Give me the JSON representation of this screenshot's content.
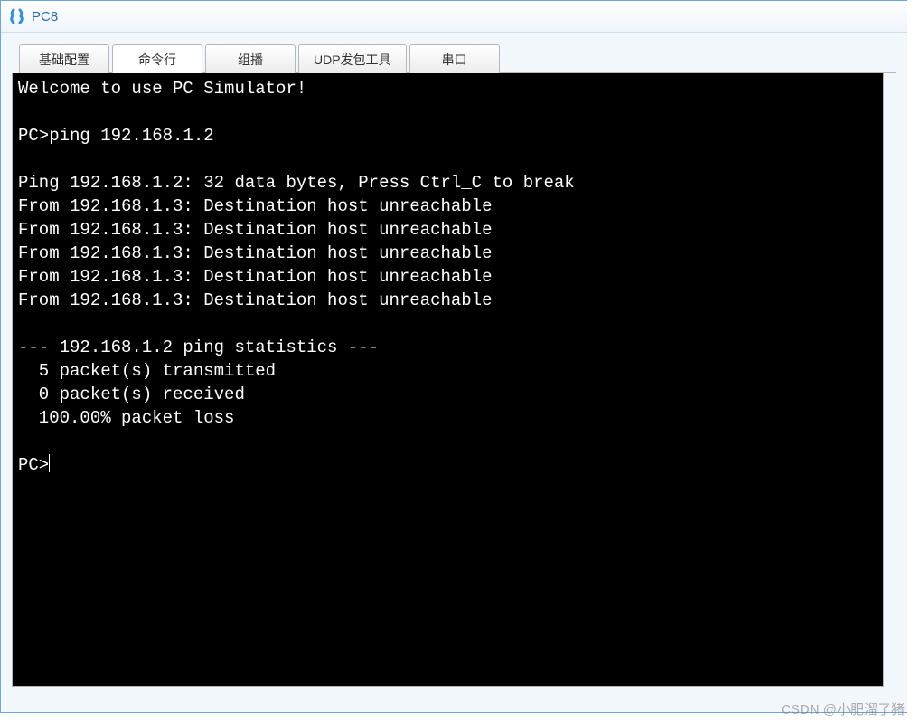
{
  "window": {
    "title": "PC8"
  },
  "tabs": [
    {
      "label": "基础配置",
      "active": false
    },
    {
      "label": "命令行",
      "active": true
    },
    {
      "label": "组播",
      "active": false
    },
    {
      "label": "UDP发包工具",
      "active": false
    },
    {
      "label": "串口",
      "active": false
    }
  ],
  "terminal": {
    "lines": [
      "Welcome to use PC Simulator!",
      "",
      "PC>ping 192.168.1.2",
      "",
      "Ping 192.168.1.2: 32 data bytes, Press Ctrl_C to break",
      "From 192.168.1.3: Destination host unreachable",
      "From 192.168.1.3: Destination host unreachable",
      "From 192.168.1.3: Destination host unreachable",
      "From 192.168.1.3: Destination host unreachable",
      "From 192.168.1.3: Destination host unreachable",
      "",
      "--- 192.168.1.2 ping statistics ---",
      "  5 packet(s) transmitted",
      "  0 packet(s) received",
      "  100.00% packet loss",
      "",
      "PC>"
    ],
    "prompt_cursor": true
  },
  "watermark": "CSDN @小肥溜了猪"
}
